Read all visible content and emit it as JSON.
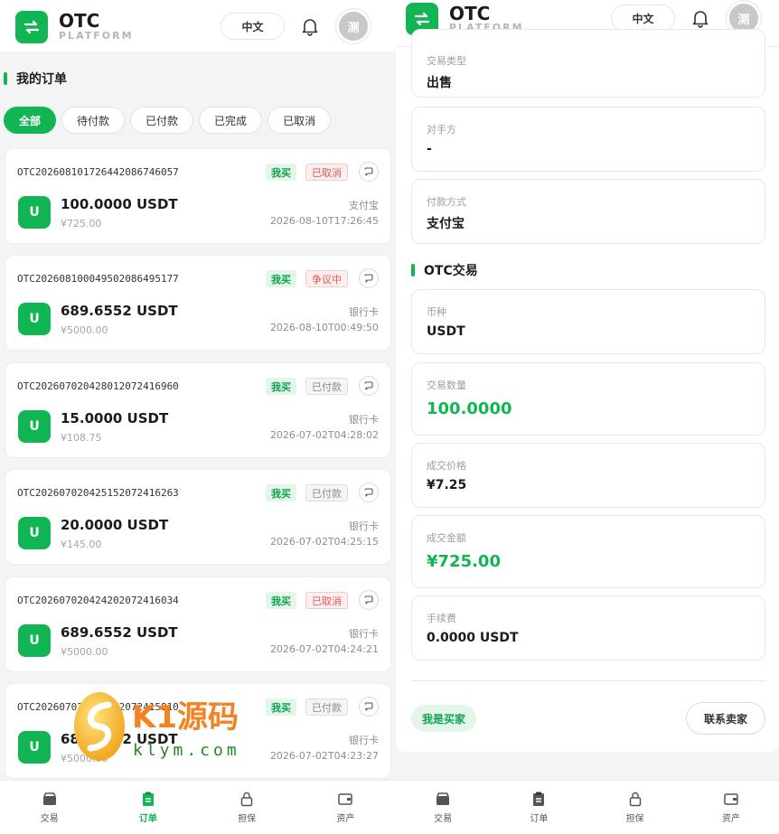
{
  "brand": {
    "title": "OTC",
    "subtitle": "PLATFORM"
  },
  "header": {
    "lang": "中文",
    "avatar_text": "测"
  },
  "orders_page": {
    "title": "我的订单",
    "tabs": [
      "全部",
      "待付款",
      "已付款",
      "已完成",
      "已取消"
    ],
    "active_tab": "全部",
    "orders": [
      {
        "no": "OTC202608101726442086746057",
        "side": "我买",
        "status": "已取消",
        "status_kind": "cancel",
        "coin": "U",
        "amount": "100.0000 USDT",
        "cny": "¥725.00",
        "pay": "支付宝",
        "time": "2026-08-10T17:26:45"
      },
      {
        "no": "OTC202608100049502086495177",
        "side": "我买",
        "status": "争议中",
        "status_kind": "dispute",
        "coin": "U",
        "amount": "689.6552 USDT",
        "cny": "¥5000.00",
        "pay": "银行卡",
        "time": "2026-08-10T00:49:50"
      },
      {
        "no": "OTC202607020428012072416960",
        "side": "我买",
        "status": "已付款",
        "status_kind": "paid",
        "coin": "U",
        "amount": "15.0000 USDT",
        "cny": "¥108.75",
        "pay": "银行卡",
        "time": "2026-07-02T04:28:02"
      },
      {
        "no": "OTC202607020425152072416263",
        "side": "我买",
        "status": "已付款",
        "status_kind": "paid",
        "coin": "U",
        "amount": "20.0000 USDT",
        "cny": "¥145.00",
        "pay": "银行卡",
        "time": "2026-07-02T04:25:15"
      },
      {
        "no": "OTC202607020424202072416034",
        "side": "我买",
        "status": "已取消",
        "status_kind": "cancel",
        "coin": "U",
        "amount": "689.6552 USDT",
        "cny": "¥5000.00",
        "pay": "银行卡",
        "time": "2026-07-02T04:24:21"
      },
      {
        "no": "OTC202607020423272072415810",
        "side": "我买",
        "status": "已付款",
        "status_kind": "paid",
        "coin": "U",
        "amount": "689.6552 USDT",
        "cny": "¥5000.00",
        "pay": "银行卡",
        "time": "2026-07-02T04:23:27"
      }
    ]
  },
  "nav": [
    {
      "label": "交易",
      "icon": "store-icon"
    },
    {
      "label": "订单",
      "icon": "clipboard-icon"
    },
    {
      "label": "担保",
      "icon": "lock-icon"
    },
    {
      "label": "资产",
      "icon": "wallet-icon"
    }
  ],
  "detail_page": {
    "trade_type_label": "交易类型",
    "trade_type_value": "出售",
    "counterparty_label": "对手方",
    "counterparty_value": "-",
    "pay_method_label": "付款方式",
    "pay_method_value": "支付宝",
    "otc_section_title": "OTC交易",
    "coin_label": "币种",
    "coin_value": "USDT",
    "qty_label": "交易数量",
    "qty_value": "100.0000",
    "price_label": "成交价格",
    "price_value": "¥7.25",
    "total_label": "成交金额",
    "total_value": "¥725.00",
    "fee_label": "手续费",
    "fee_value": "0.0000 USDT",
    "role_tag": "我是买家",
    "contact_button": "联系卖家"
  },
  "watermark": {
    "text": "K1源码",
    "url": "klym.com"
  },
  "colors": {
    "accent": "#12b554",
    "cancel": "#e05a5a",
    "dispute": "#e05a5a",
    "paid": "#8a8f8d"
  }
}
